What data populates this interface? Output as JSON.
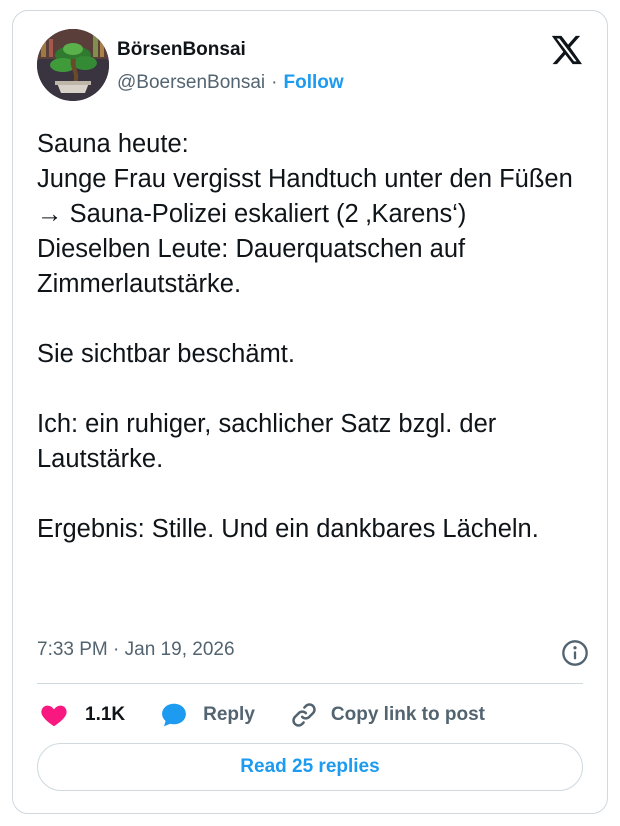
{
  "author": {
    "display_name": "BörsenBonsai",
    "handle": "@BoersenBonsai",
    "separator": "·",
    "follow_label": "Follow",
    "avatar_icon": "bonsai-tree-avatar"
  },
  "platform_icon": "x-logo-icon",
  "tweet": {
    "text": "Sauna heute:\nJunge Frau vergisst Handtuch unter den Füßen → Sauna-Polizei eskaliert (2 ‚Karens‘)\nDieselben Leute: Dauerquatschen auf Zimmerlautstärke.\n\nSie sichtbar beschämt.\n\nIch: ein ruhiger, sachlicher Satz bzgl. der Lautstärke.\n\nErgebnis: Stille. Und ein dankbares Lächeln.",
    "timestamp": "7:33 PM · Jan 19, 2026"
  },
  "actions": {
    "like_count": "1.1K",
    "reply_label": "Reply",
    "copy_label": "Copy link to post"
  },
  "read_replies_label": "Read 25 replies",
  "colors": {
    "accent": "#1d9bf0",
    "like": "#f91880",
    "text_primary": "#0f1419",
    "text_secondary": "#536471",
    "border": "#cfd9de"
  }
}
